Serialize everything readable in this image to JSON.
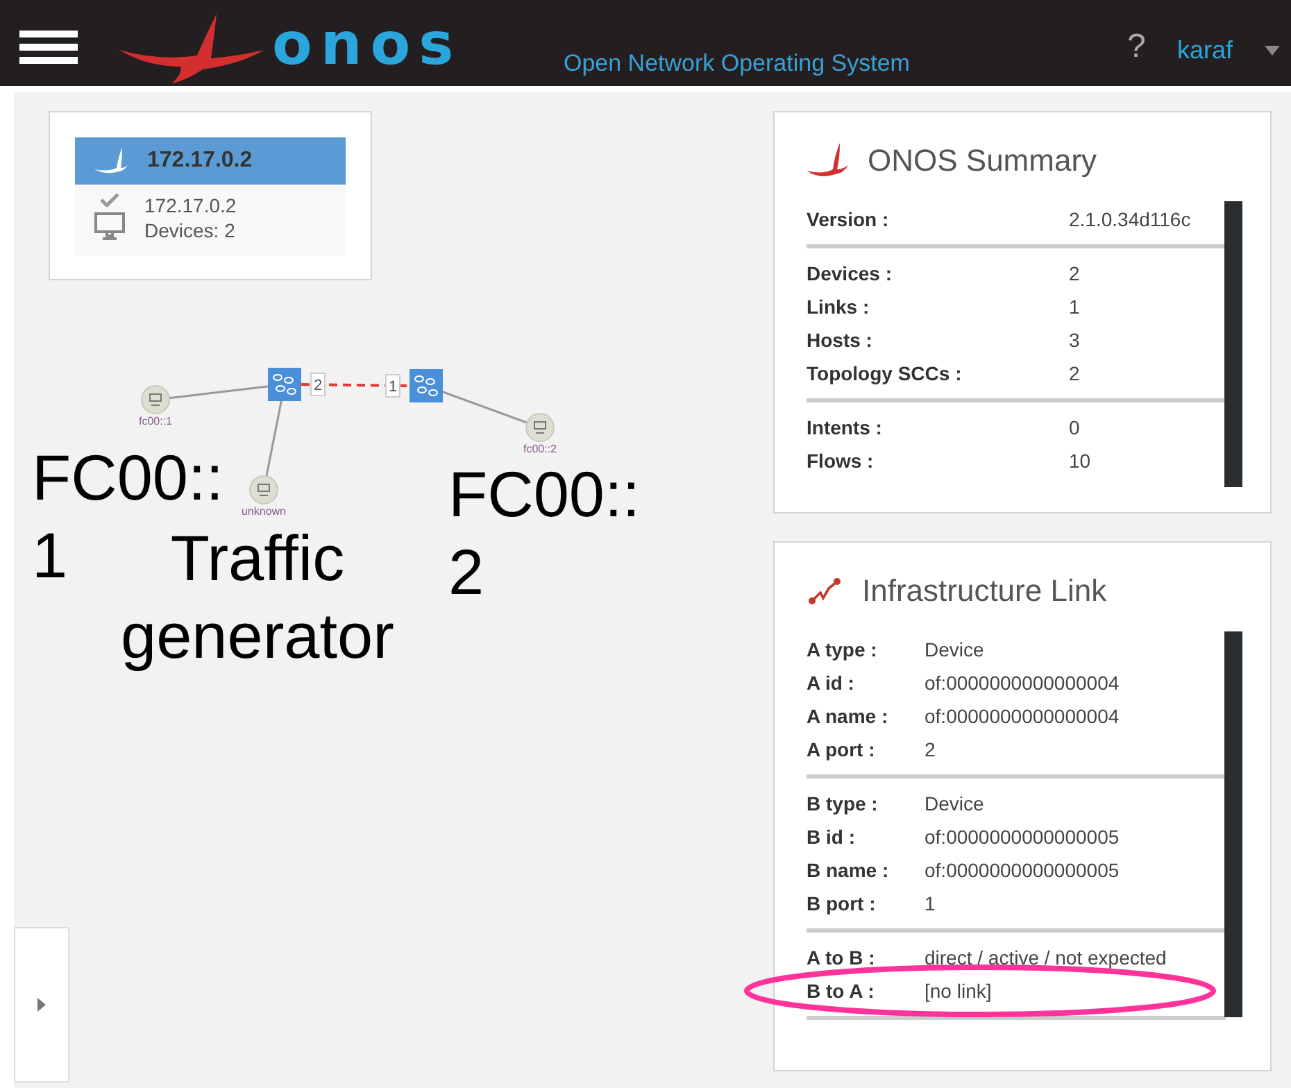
{
  "navbar": {
    "logo": "onos",
    "tagline": "Open Network Operating System",
    "help": "?",
    "user": "karaf"
  },
  "cluster_panel": {
    "header": {
      "label": "172.17.0.2",
      "selected": true
    },
    "node": {
      "ip": "172.17.0.2",
      "devices": "Devices: 2"
    }
  },
  "topology": {
    "devices": [
      {
        "port": "2"
      },
      {
        "port": "1"
      }
    ],
    "hosts": [
      {
        "label": "fc00::1"
      },
      {
        "label": "unknown"
      },
      {
        "label": "fc00::2"
      }
    ]
  },
  "annotations": [
    {
      "lines": [
        "FC00::",
        "1"
      ]
    },
    {
      "lines": [
        "Traffic",
        "generator"
      ]
    },
    {
      "lines": [
        "FC00::",
        "2"
      ]
    }
  ],
  "summary_panel": {
    "title": "ONOS Summary",
    "sections": [
      [
        {
          "label": "Version :",
          "value": "2.1.0.34d116c"
        }
      ],
      [
        {
          "label": "Devices :",
          "value": "2"
        },
        {
          "label": "Links :",
          "value": "1"
        },
        {
          "label": "Hosts :",
          "value": "3"
        },
        {
          "label": "Topology SCCs :",
          "value": "2"
        }
      ],
      [
        {
          "label": "Intents :",
          "value": "0"
        },
        {
          "label": "Flows :",
          "value": "10"
        }
      ]
    ]
  },
  "link_panel": {
    "title": "Infrastructure Link",
    "sections": [
      [
        {
          "label": "A type :",
          "value": "Device",
          "highlighted": false
        },
        {
          "label": "A id :",
          "value": "of:0000000000000004",
          "highlighted": false
        },
        {
          "label": "A name :",
          "value": "of:0000000000000004",
          "highlighted": false
        },
        {
          "label": "A port :",
          "value": "2",
          "highlighted": false
        }
      ],
      [
        {
          "label": "B type :",
          "value": "Device",
          "highlighted": false
        },
        {
          "label": "B id :",
          "value": "of:0000000000000005",
          "highlighted": false
        },
        {
          "label": "B name :",
          "value": "of:0000000000000005",
          "highlighted": false
        },
        {
          "label": "B port :",
          "value": "1",
          "highlighted": false
        }
      ],
      [
        {
          "label": "A to B :",
          "value": "direct / active / not expected",
          "highlighted": false
        },
        {
          "label": "B to A :",
          "value": "[no link]",
          "highlighted": true
        }
      ]
    ]
  }
}
